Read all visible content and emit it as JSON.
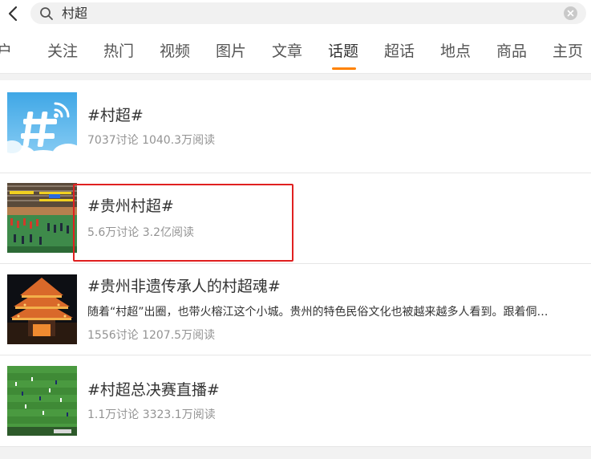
{
  "search": {
    "query": "村超",
    "placeholder": ""
  },
  "icons": {
    "back": "chevron-left-icon",
    "search": "magnifier-icon",
    "clear": "clear-circle-icon"
  },
  "tabs": [
    {
      "label": "户"
    },
    {
      "label": "关注"
    },
    {
      "label": "热门"
    },
    {
      "label": "视频"
    },
    {
      "label": "图片"
    },
    {
      "label": "文章"
    },
    {
      "label": "话题",
      "active": true
    },
    {
      "label": "超话"
    },
    {
      "label": "地点"
    },
    {
      "label": "商品"
    },
    {
      "label": "主页"
    }
  ],
  "colors": {
    "accent": "#ff8200",
    "highlight_box": "#e02020",
    "stats_text": "#939393"
  },
  "topics": [
    {
      "title": "#村超#",
      "stats": "7037讨论 1040.3万阅读",
      "thumbnail": "hashtag-topic-icon"
    },
    {
      "title": "#贵州村超#",
      "stats": "5.6万讨论 3.2亿阅读",
      "thumbnail": "stadium-photo",
      "highlighted": true
    },
    {
      "title": "#贵州非遗传承人的村超魂#",
      "description": "随着“村超”出圈，也带火榕江这个小城。贵州的特色民俗文化也被越来越多人看到。跟着侗…",
      "stats": "1556讨论 1207.5万阅读",
      "thumbnail": "drum-tower-night-photo"
    },
    {
      "title": "#村超总决赛直播#",
      "stats": "1.1万讨论 3323.1万阅读",
      "thumbnail": "football-pitch-photo"
    }
  ]
}
